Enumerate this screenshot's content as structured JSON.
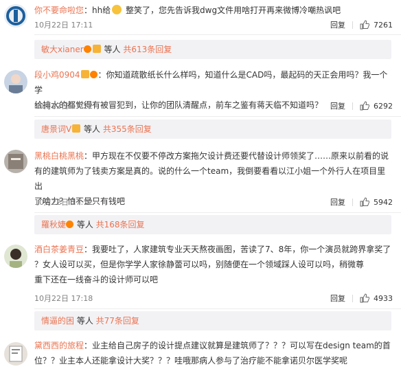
{
  "comments": [
    {
      "user": "你不要命啦您",
      "text": "：hh给",
      "text_after": " 整笑了，您先告诉我dwg文件用啥打开再来微博冷嘲热讽吧",
      "date": "10月22日 17:11",
      "reply_label": "回复",
      "likes": "7261",
      "sub": {
        "name": "敏大xianer",
        "mid": " 等人 ",
        "count": "共613条回复"
      }
    },
    {
      "user": "段小鸡0904",
      "text_line1": "：你知道疏散纸长什么样吗，知道什么是CAD吗，最起码的天正会用吗？我一个学",
      "text_line2": "给排水的都觉得有被冒犯到，让你的团队清醒点，前车之鉴有蒋天临不知道吗？",
      "date": "10月22日 17:22",
      "reply_label": "回复",
      "likes": "6292",
      "sub": {
        "name": "唐景词V",
        "mid": " 等人 ",
        "count": "共355条回复"
      }
    },
    {
      "user": "黑桃白桃黑桃",
      "text_line1": "：甲方现在不仅要不停改方案拖欠设计费还要代替设计师领奖了……原来以前看的说",
      "text_line2": "有的建筑师为了钱卖方案是真的。说的什么一个team，我倒要看看以江小姐一个外行人在项目里出",
      "text_line3": "了啥力？怕不是只有钱吧",
      "date": "10月22日 17:12",
      "reply_label": "回复",
      "likes": "5942",
      "sub": {
        "name": "羅秋婕",
        "mid": " 等人 ",
        "count": "共168条回复"
      }
    },
    {
      "user": "酒白茶姜青豆",
      "text_line1": "：我要吐了，人家建筑专业天天熬夜画图，苦读了7、8年，你一个演员就跨界拿奖了",
      "text_line2": "？女人设可以买，但是你学学人家徐静蕾可以吗，别随便在一个领域踩人设可以吗，稍微尊",
      "text_line3": "重下还在一线奋斗的设计师可以吧",
      "date": "10月22日 17:18",
      "reply_label": "回复",
      "likes": "4933",
      "sub": {
        "name": "情逼的困",
        "mid": " 等人 ",
        "count": "共77条回复"
      }
    },
    {
      "user": "黛西西的旅程",
      "text_line1": "：业主给自己房子的设计提点建议就算是建筑师了？？？可以写在design team的首",
      "text_line2": "位？？业主本人还能拿设计大奖？？？哇哦那病人参与了治疗能不能拿诺贝尔医学奖呢"
    }
  ],
  "colors": {
    "username": "#eb7350",
    "subreply_bg": "#f2f2f5",
    "meta": "#808080"
  },
  "icons": {
    "like": "thumbs-up-icon",
    "vip": "vip-badge-icon",
    "member": "member-badge-icon"
  }
}
